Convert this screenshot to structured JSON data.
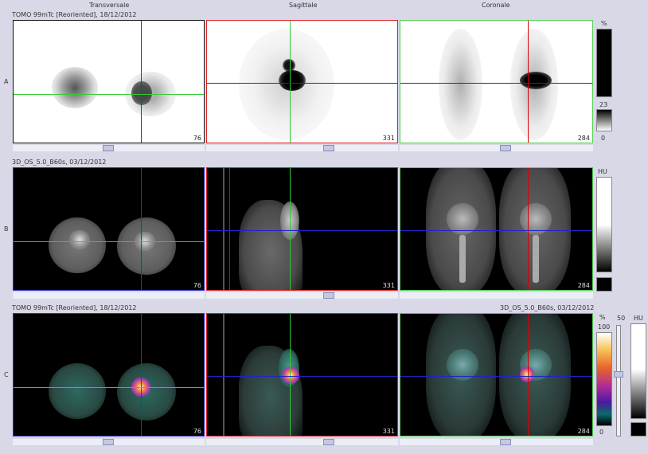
{
  "headers": {
    "transversale": "Transversale",
    "sagittale": "Sagittale",
    "coronale": "Coronale"
  },
  "rows": {
    "a": {
      "label": "A",
      "series": "TOMO 99mTc [Reoriented], 18/12/2012"
    },
    "b": {
      "label": "B",
      "series": "3D_OS_5.0_B60s, 03/12/2012"
    },
    "c": {
      "label": "C",
      "series_left": "TOMO 99mTc [Reoriented], 18/12/2012",
      "series_right": "3D_OS_5.0_B60s, 03/12/2012"
    }
  },
  "slices": {
    "transversale": "76",
    "sagittale": "331",
    "coronale": "284"
  },
  "colorbar_a": {
    "unit": "%",
    "mid": "23",
    "min": "0"
  },
  "colorbar_b": {
    "unit": "HU"
  },
  "colorbar_c": {
    "unit_pct": "%",
    "max": "100",
    "min": "0",
    "threshold": "50",
    "unit_hu": "HU"
  }
}
